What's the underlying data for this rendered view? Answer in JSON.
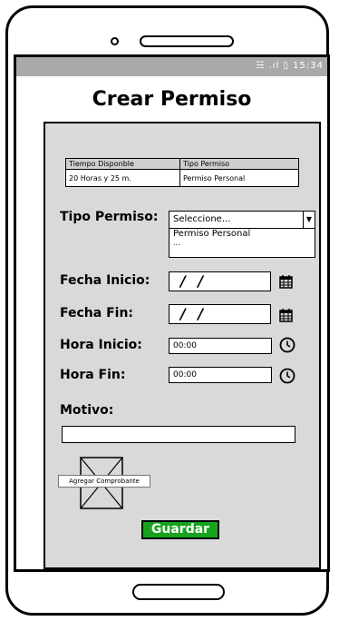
{
  "status_bar": {
    "icons": "wifi-signal-battery",
    "time": "15:34"
  },
  "header": {
    "title": "Crear Permiso"
  },
  "info_table": {
    "col1_header": "Tiempo Disponble",
    "col2_header": "Tipo Permiso",
    "col1_value": "20 Horas y 25 m.",
    "col2_value": "Permiso Personal"
  },
  "form": {
    "tipo_permiso_label": "Tipo Permiso:",
    "tipo_permiso_selected": "Seleccione...",
    "tipo_permiso_options": [
      "Permiso Personal",
      "..."
    ],
    "fecha_inicio_label": "Fecha Inicio:",
    "fecha_inicio_value": "/ /",
    "fecha_fin_label": "Fecha Fin:",
    "fecha_fin_value": "/ /",
    "hora_inicio_label": "Hora Inicio:",
    "hora_inicio_value": "00:00",
    "hora_fin_label": "Hora Fin:",
    "hora_fin_value": "00:00",
    "motivo_label": "Motivo:",
    "motivo_value": "",
    "comprobante_label": "Agregar Comprobante",
    "save_label": "Guardar"
  },
  "colors": {
    "status_bar": "#a9a9a9",
    "panel": "#d9d9d9",
    "save_button": "#18a31e"
  }
}
